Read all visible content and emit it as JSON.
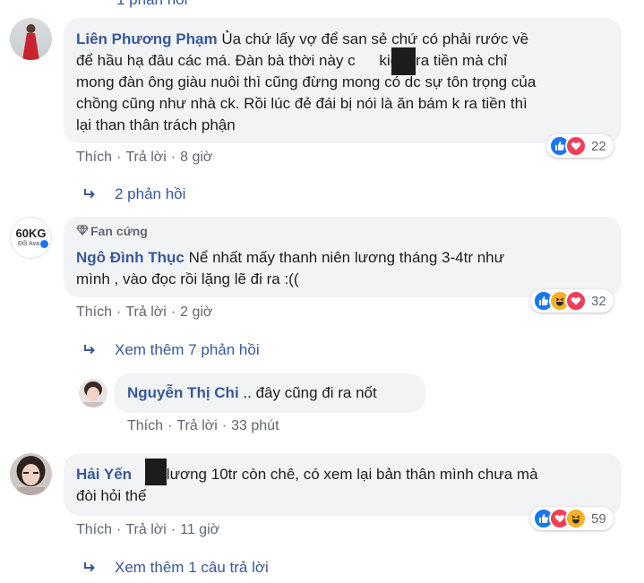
{
  "top_partial": {
    "text": "1 phản hồi"
  },
  "comments": [
    {
      "author": "Liên Phương Phạm",
      "text": "Ủa chứ lấy vợ để san sẻ chứ có phải rước về để hầu hạ đâu các má. Đàn bà thời này c kiếm ra tiền mà chỉ mong đàn ông giàu nuôi thì cũng đừng mong có dc sự tôn trọng của chồng cũng như nhà ck. Rồi lúc đẻ đái bị nói là ăn bám k ra tiền thì lại than thân trách phận",
      "lines": [
        "Ủa chứ lấy vợ để san sẻ chứ có phải rước về",
        "để hầu hạ đâu các má. Đàn bà thời này c",
        "kiếm ra tiền mà chỉ",
        "mong đàn ông giàu nuôi thì cũng đừng mong có dc sự tôn trọng của",
        "chồng cũng như nhà ck. Rồi lúc đẻ đái bị nói là ăn bám k ra tiền thì",
        "lại than thân trách phận"
      ],
      "like": "Thích",
      "reply": "Trả lời",
      "time": "8 giờ",
      "reactions": [
        "like",
        "love"
      ],
      "reaction_count": "22",
      "replies_link": "2 phản hồi"
    },
    {
      "badge": "Fan cứng",
      "avatar_text": "60KG",
      "avatar_subtext": "Đổi Ava",
      "author": "Ngô Đình Thục",
      "text": "Nể nhất mấy thanh niên lương tháng 3-4tr như mình , vào đọc rồi lặng lẽ đi ra :((",
      "lines": [
        "Nể nhất mấy thanh niên lương tháng 3-4tr như",
        "mình , vào đọc rồi lặng lẽ đi ra :(("
      ],
      "like": "Thích",
      "reply": "Trả lời",
      "time": "2 giờ",
      "reactions": [
        "like",
        "haha",
        "love"
      ],
      "reaction_count": "32",
      "replies_link": "Xem thêm 7 phản hồi"
    },
    {
      "author": "Nguyễn Thị Chi",
      "text": ".. đây cũng đi ra nốt",
      "like": "Thích",
      "reply": "Trả lời",
      "time": "33 phút"
    },
    {
      "author": "Hải Yến",
      "text": "lương 10tr còn chê, có xem lại bản thân mình chưa mà đòi hỏi thế",
      "lines": [
        "lương 10tr còn chê, có xem lại bản thân mình chưa mà",
        "đòi hỏi thế"
      ],
      "like": "Thích",
      "reply": "Trả lời",
      "time": "11 giờ",
      "reactions": [
        "like",
        "love",
        "haha"
      ],
      "reaction_count": "59",
      "replies_link": "Xem thêm 1 câu trả lời"
    }
  ],
  "icons": {
    "reply_arrow": "reply-arrow-icon",
    "badge": "diamond-icon",
    "like": "like-reaction-icon",
    "love": "love-reaction-icon",
    "haha": "haha-reaction-icon"
  },
  "colors": {
    "author": "#385898",
    "bubble": "#f2f3f5",
    "meta": "#606770",
    "like": "#1877f2",
    "love": "#f33e58",
    "haha": "#f7b125"
  }
}
